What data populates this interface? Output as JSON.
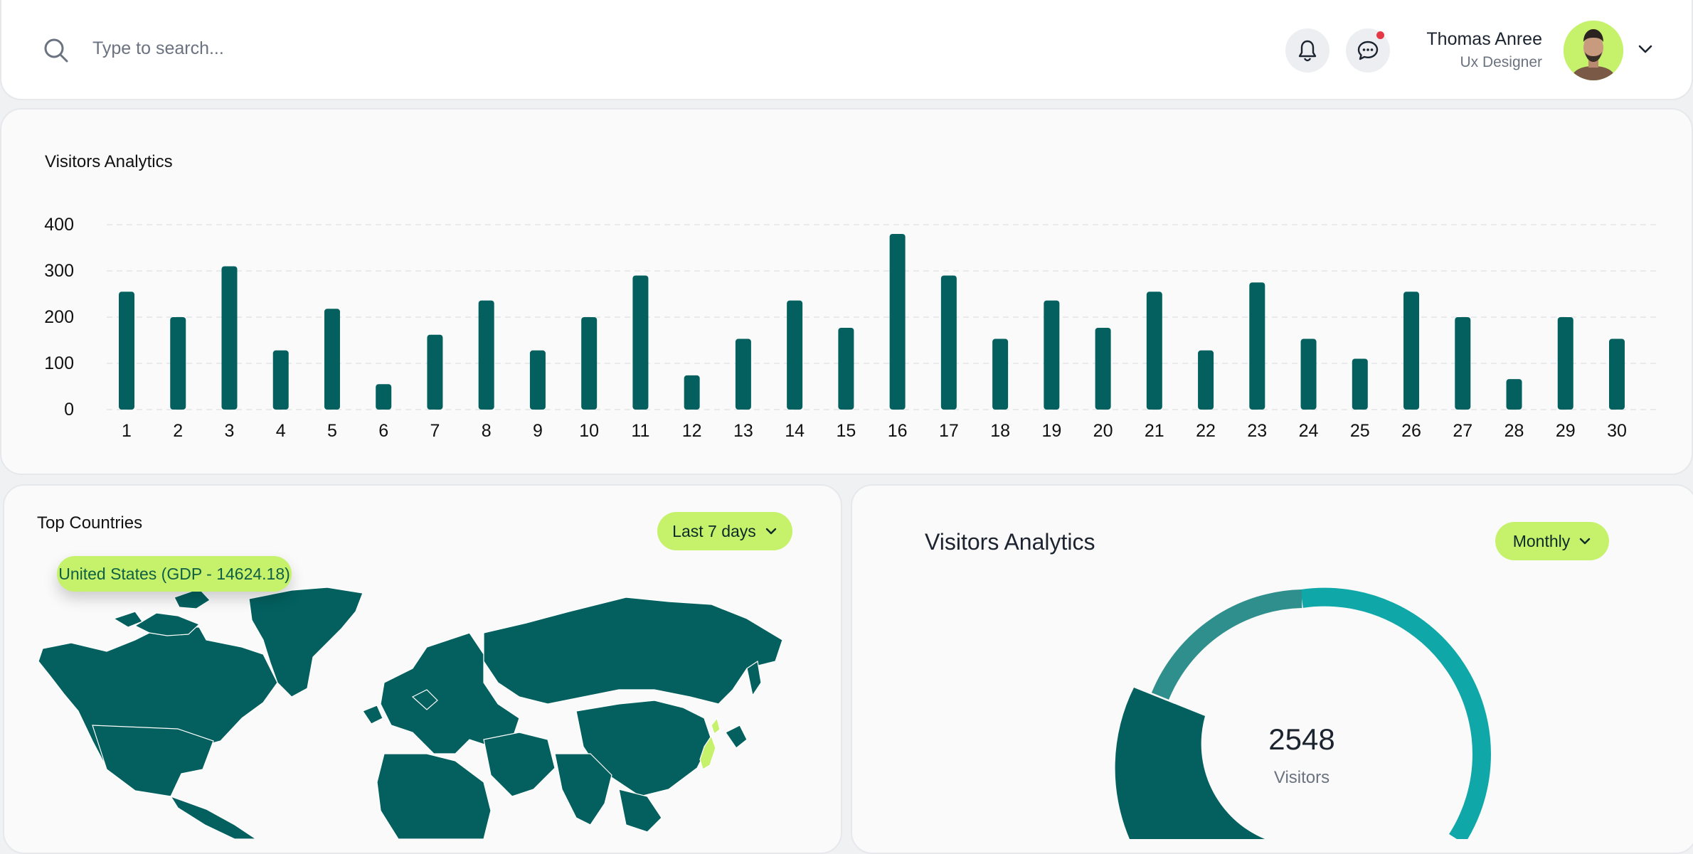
{
  "header": {
    "search_placeholder": "Type to search...",
    "user_name": "Thomas Anree",
    "user_role": "Ux Designer",
    "icons": [
      "search-icon",
      "bell-icon",
      "chat-icon",
      "chevron-down-icon"
    ]
  },
  "visitors_chart": {
    "title": "Visitors Analytics"
  },
  "chart_data": {
    "type": "bar",
    "title": "Visitors Analytics",
    "xlabel": "",
    "ylabel": "",
    "ylim": [
      0,
      400
    ],
    "yticks": [
      0,
      100,
      200,
      300,
      400
    ],
    "grid": true,
    "categories": [
      "1",
      "2",
      "3",
      "4",
      "5",
      "6",
      "7",
      "8",
      "9",
      "10",
      "11",
      "12",
      "13",
      "14",
      "15",
      "16",
      "17",
      "18",
      "19",
      "20",
      "21",
      "22",
      "23",
      "24",
      "25",
      "26",
      "27",
      "28",
      "29",
      "30"
    ],
    "values": [
      255,
      200,
      310,
      128,
      218,
      55,
      162,
      236,
      128,
      200,
      290,
      74,
      153,
      236,
      177,
      380,
      290,
      153,
      236,
      177,
      255,
      128,
      275,
      153,
      110,
      255,
      200,
      66,
      200,
      153
    ],
    "color": "#03605f"
  },
  "top_countries": {
    "title": "Top Countries",
    "range_label": "Last 7 days",
    "tooltip": "United States (GDP - 14624.18)",
    "map_color": "#03605f",
    "highlight_color": "#c5f26a"
  },
  "donut": {
    "title": "Visitors Analytics",
    "range_label": "Monthly",
    "value": "2548",
    "label": "Visitors",
    "colors": [
      "#03605f",
      "#2f8f8c",
      "#10a7a8"
    ]
  },
  "colors": {
    "accent": "#c5f26a",
    "primary": "#03605f"
  }
}
